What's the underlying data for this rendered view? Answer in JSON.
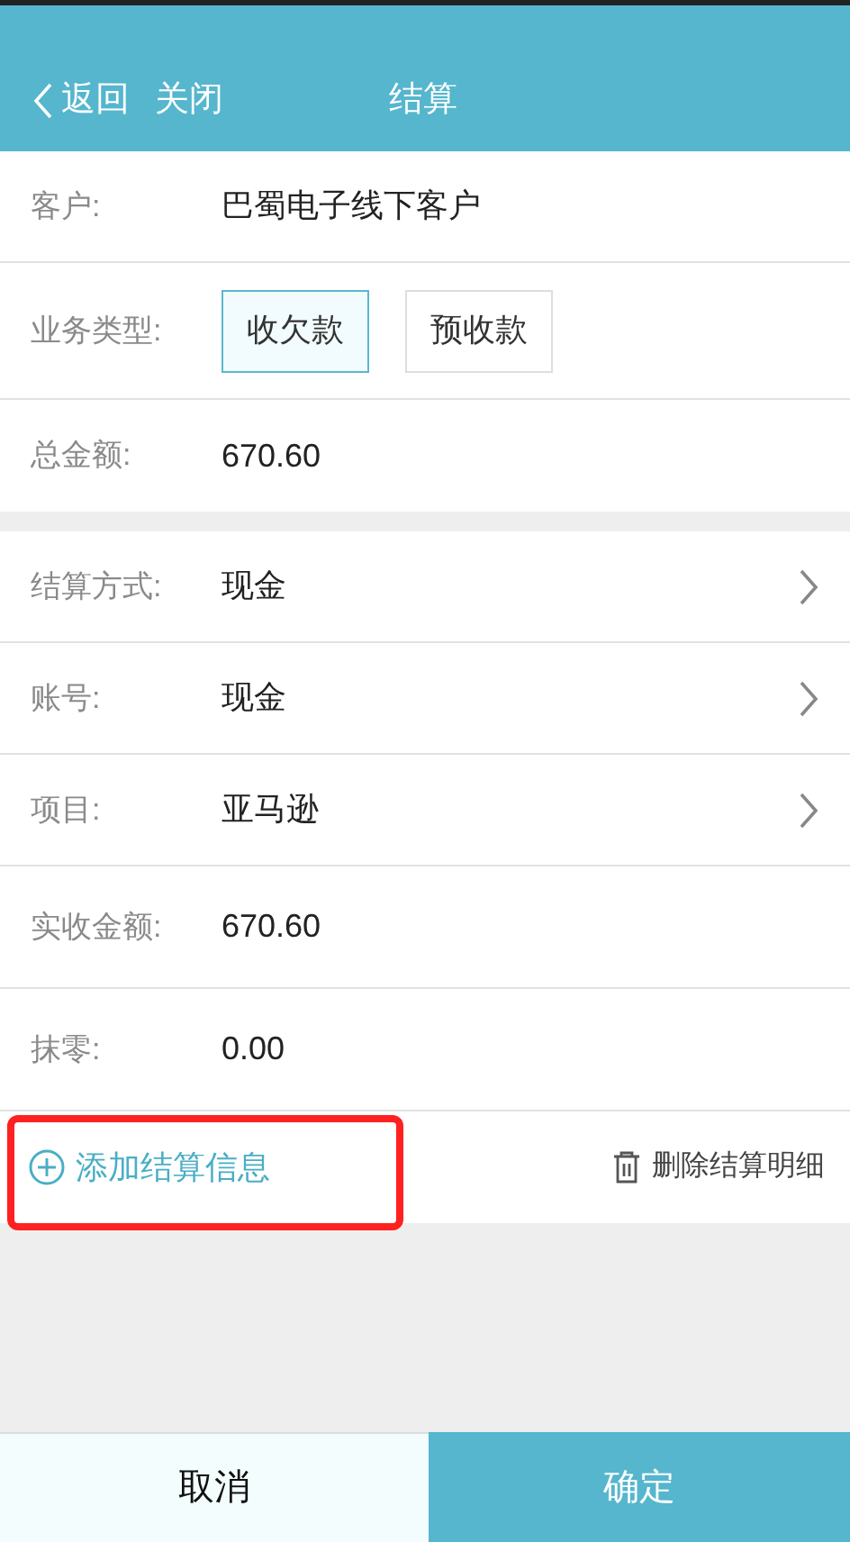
{
  "header": {
    "back": "返回",
    "close": "关闭",
    "title": "结算"
  },
  "business_section": [
    {
      "kind": "text",
      "label": "客户:",
      "value": "巴蜀电子线下客户"
    },
    {
      "kind": "choice",
      "label": "业务类型:",
      "options": [
        {
          "label": "收欠款",
          "selected": true
        },
        {
          "label": "预收款",
          "selected": false
        }
      ]
    },
    {
      "kind": "text",
      "label": "总金额:",
      "value": "670.60"
    }
  ],
  "settlement_section": [
    {
      "kind": "select",
      "label": "结算方式:",
      "value": "现金"
    },
    {
      "kind": "select",
      "label": "账号:",
      "value": "现金"
    },
    {
      "kind": "select",
      "label": "项目:",
      "value": "亚马逊"
    },
    {
      "kind": "text",
      "label": "实收金额:",
      "value": "670.60"
    },
    {
      "kind": "text",
      "label": "抹零:",
      "value": "0.00"
    }
  ],
  "actions": {
    "add": {
      "label": "添加结算信息",
      "highlighted": true
    },
    "delete": {
      "label": "删除结算明细"
    }
  },
  "footer": {
    "cancel": "取消",
    "confirm": "确定"
  }
}
